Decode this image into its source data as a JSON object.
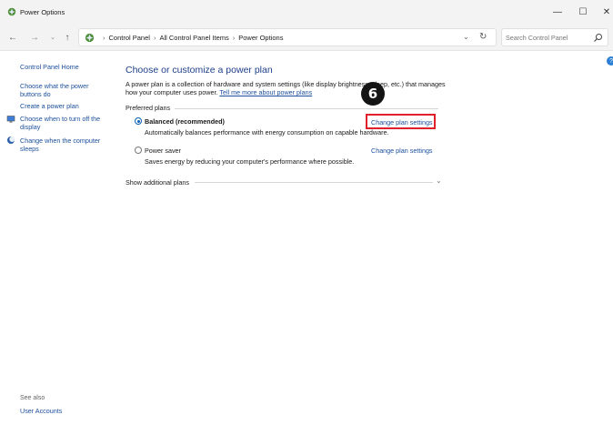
{
  "window": {
    "title": "Power Options"
  },
  "breadcrumb": [
    "Control Panel",
    "All Control Panel Items",
    "Power Options"
  ],
  "search": {
    "placeholder": "Search Control Panel"
  },
  "sidebar": {
    "home": "Control Panel Home",
    "links": [
      "Choose what the power buttons do",
      "Create a power plan",
      "Choose when to turn off the display",
      "Change when the computer sleeps"
    ],
    "see_also_label": "See also",
    "see_also_links": [
      "User Accounts"
    ]
  },
  "main": {
    "heading": "Choose or customize a power plan",
    "description": "A power plan is a collection of hardware and system settings (like display brightness, sleep, etc.) that manages how your computer uses power.",
    "description_link": "Tell me more about power plans",
    "group_label": "Preferred plans",
    "plans": [
      {
        "name": "Balanced (recommended)",
        "description": "Automatically balances performance with energy consumption on capable hardware.",
        "link": "Change plan settings",
        "selected": true
      },
      {
        "name": "Power saver",
        "description": "Saves energy by reducing your computer's performance where possible.",
        "link": "Change plan settings",
        "selected": false
      }
    ],
    "show_additional": "Show additional plans"
  },
  "annotation": {
    "step_number": "6",
    "highlight_color": "#e0202a"
  },
  "colors": {
    "link": "#1b4f9c",
    "heading": "#1e3f8a",
    "accent": "#0a5fb4"
  },
  "icons": {
    "back": "←",
    "forward": "→",
    "dropdown": "⌄",
    "up": "↑",
    "breadcrumb_separator": "›",
    "address_dropdown": "⌄",
    "refresh": "↻",
    "minimize": "—",
    "maximize": "☐",
    "close": "✕",
    "show_more": "⌄",
    "help": "?"
  }
}
